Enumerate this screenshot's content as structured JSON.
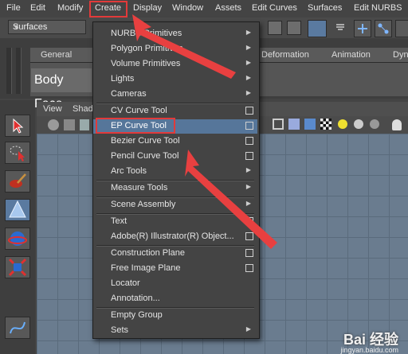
{
  "menubar": {
    "items": [
      "File",
      "Edit",
      "Modify",
      "Create",
      "Display",
      "Window",
      "Assets",
      "Edit Curves",
      "Surfaces",
      "Edit NURBS"
    ]
  },
  "toolbar": {
    "menuset": "Surfaces"
  },
  "shelf": {
    "tabs": [
      "General",
      "Deformation",
      "Animation",
      "Dyn"
    ],
    "body_face_label": "Body Face"
  },
  "viewport": {
    "menu_view": "View",
    "menu_shading": "Shad"
  },
  "create_menu": {
    "items": [
      {
        "label": "NURBS Primitives",
        "submenu": true
      },
      {
        "label": "Polygon Primitives",
        "submenu": true
      },
      {
        "label": "Volume Primitives",
        "submenu": true
      },
      {
        "label": "Lights",
        "submenu": true
      },
      {
        "label": "Cameras",
        "submenu": true
      },
      {
        "label": "CV Curve Tool",
        "option": true
      },
      {
        "label": "EP Curve Tool",
        "option": true,
        "selected": true
      },
      {
        "label": "Bezier Curve Tool",
        "option": true
      },
      {
        "label": "Pencil Curve Tool",
        "option": true
      },
      {
        "label": "Arc Tools",
        "submenu": true
      },
      {
        "label": "Measure Tools",
        "submenu": true
      },
      {
        "label": "Scene Assembly",
        "submenu": true
      },
      {
        "label": "Text",
        "option": true
      },
      {
        "label": "Adobe(R) Illustrator(R) Object...",
        "option": true
      },
      {
        "label": "Construction Plane",
        "option": true
      },
      {
        "label": "Free Image Plane",
        "option": true
      },
      {
        "label": "Locator"
      },
      {
        "label": "Annotation..."
      },
      {
        "label": "Empty Group"
      },
      {
        "label": "Sets",
        "submenu": true
      }
    ]
  },
  "watermark": {
    "brand": "Bai 经验",
    "url": "jingyan.baidu.com"
  },
  "colors": {
    "highlight": "#e23a3a",
    "selection": "#56769a",
    "arrow": "#e84040"
  }
}
